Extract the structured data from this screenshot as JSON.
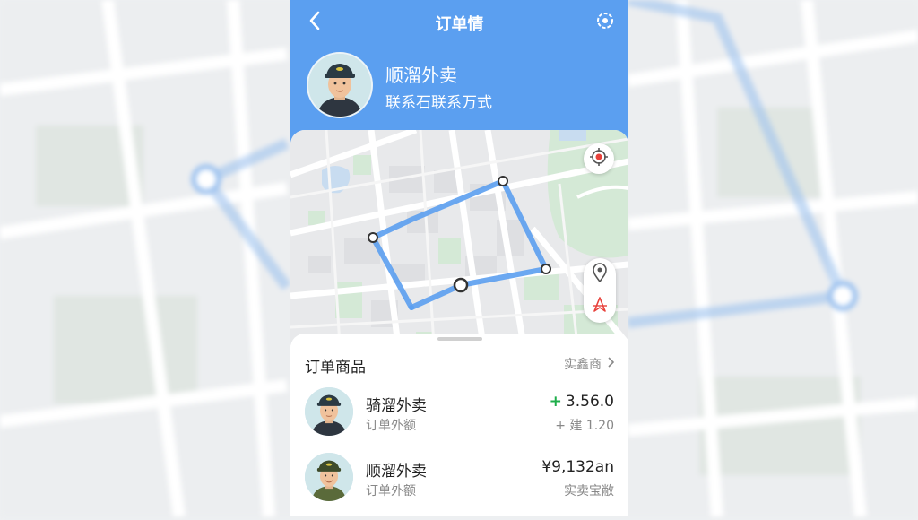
{
  "header": {
    "title": "订单情",
    "back_icon": "chevron-left-icon",
    "right_icon": "settings-icon"
  },
  "rider": {
    "name": "顺溜外卖",
    "contact": "联系石联系万式"
  },
  "map": {
    "route_color": "#5b9ff0",
    "locate_icon": "target-icon",
    "pin_icon": "location-pin-icon",
    "route_icon": "navigation-icon"
  },
  "order": {
    "section_title": "订单商品",
    "link_label": "实鑫商",
    "items": [
      {
        "name": "骑溜外卖",
        "sub": "订单外额",
        "price_prefix": "+",
        "price": "3.56.0",
        "extra": "+ 建 1.20"
      },
      {
        "name": "顺溜外卖",
        "sub": "订单外额",
        "price_prefix": "",
        "price": "¥9,132an",
        "extra": "实卖宝敝"
      }
    ]
  },
  "colors": {
    "header_bg": "#5b9ff0",
    "accent_green": "#1fae4b"
  }
}
